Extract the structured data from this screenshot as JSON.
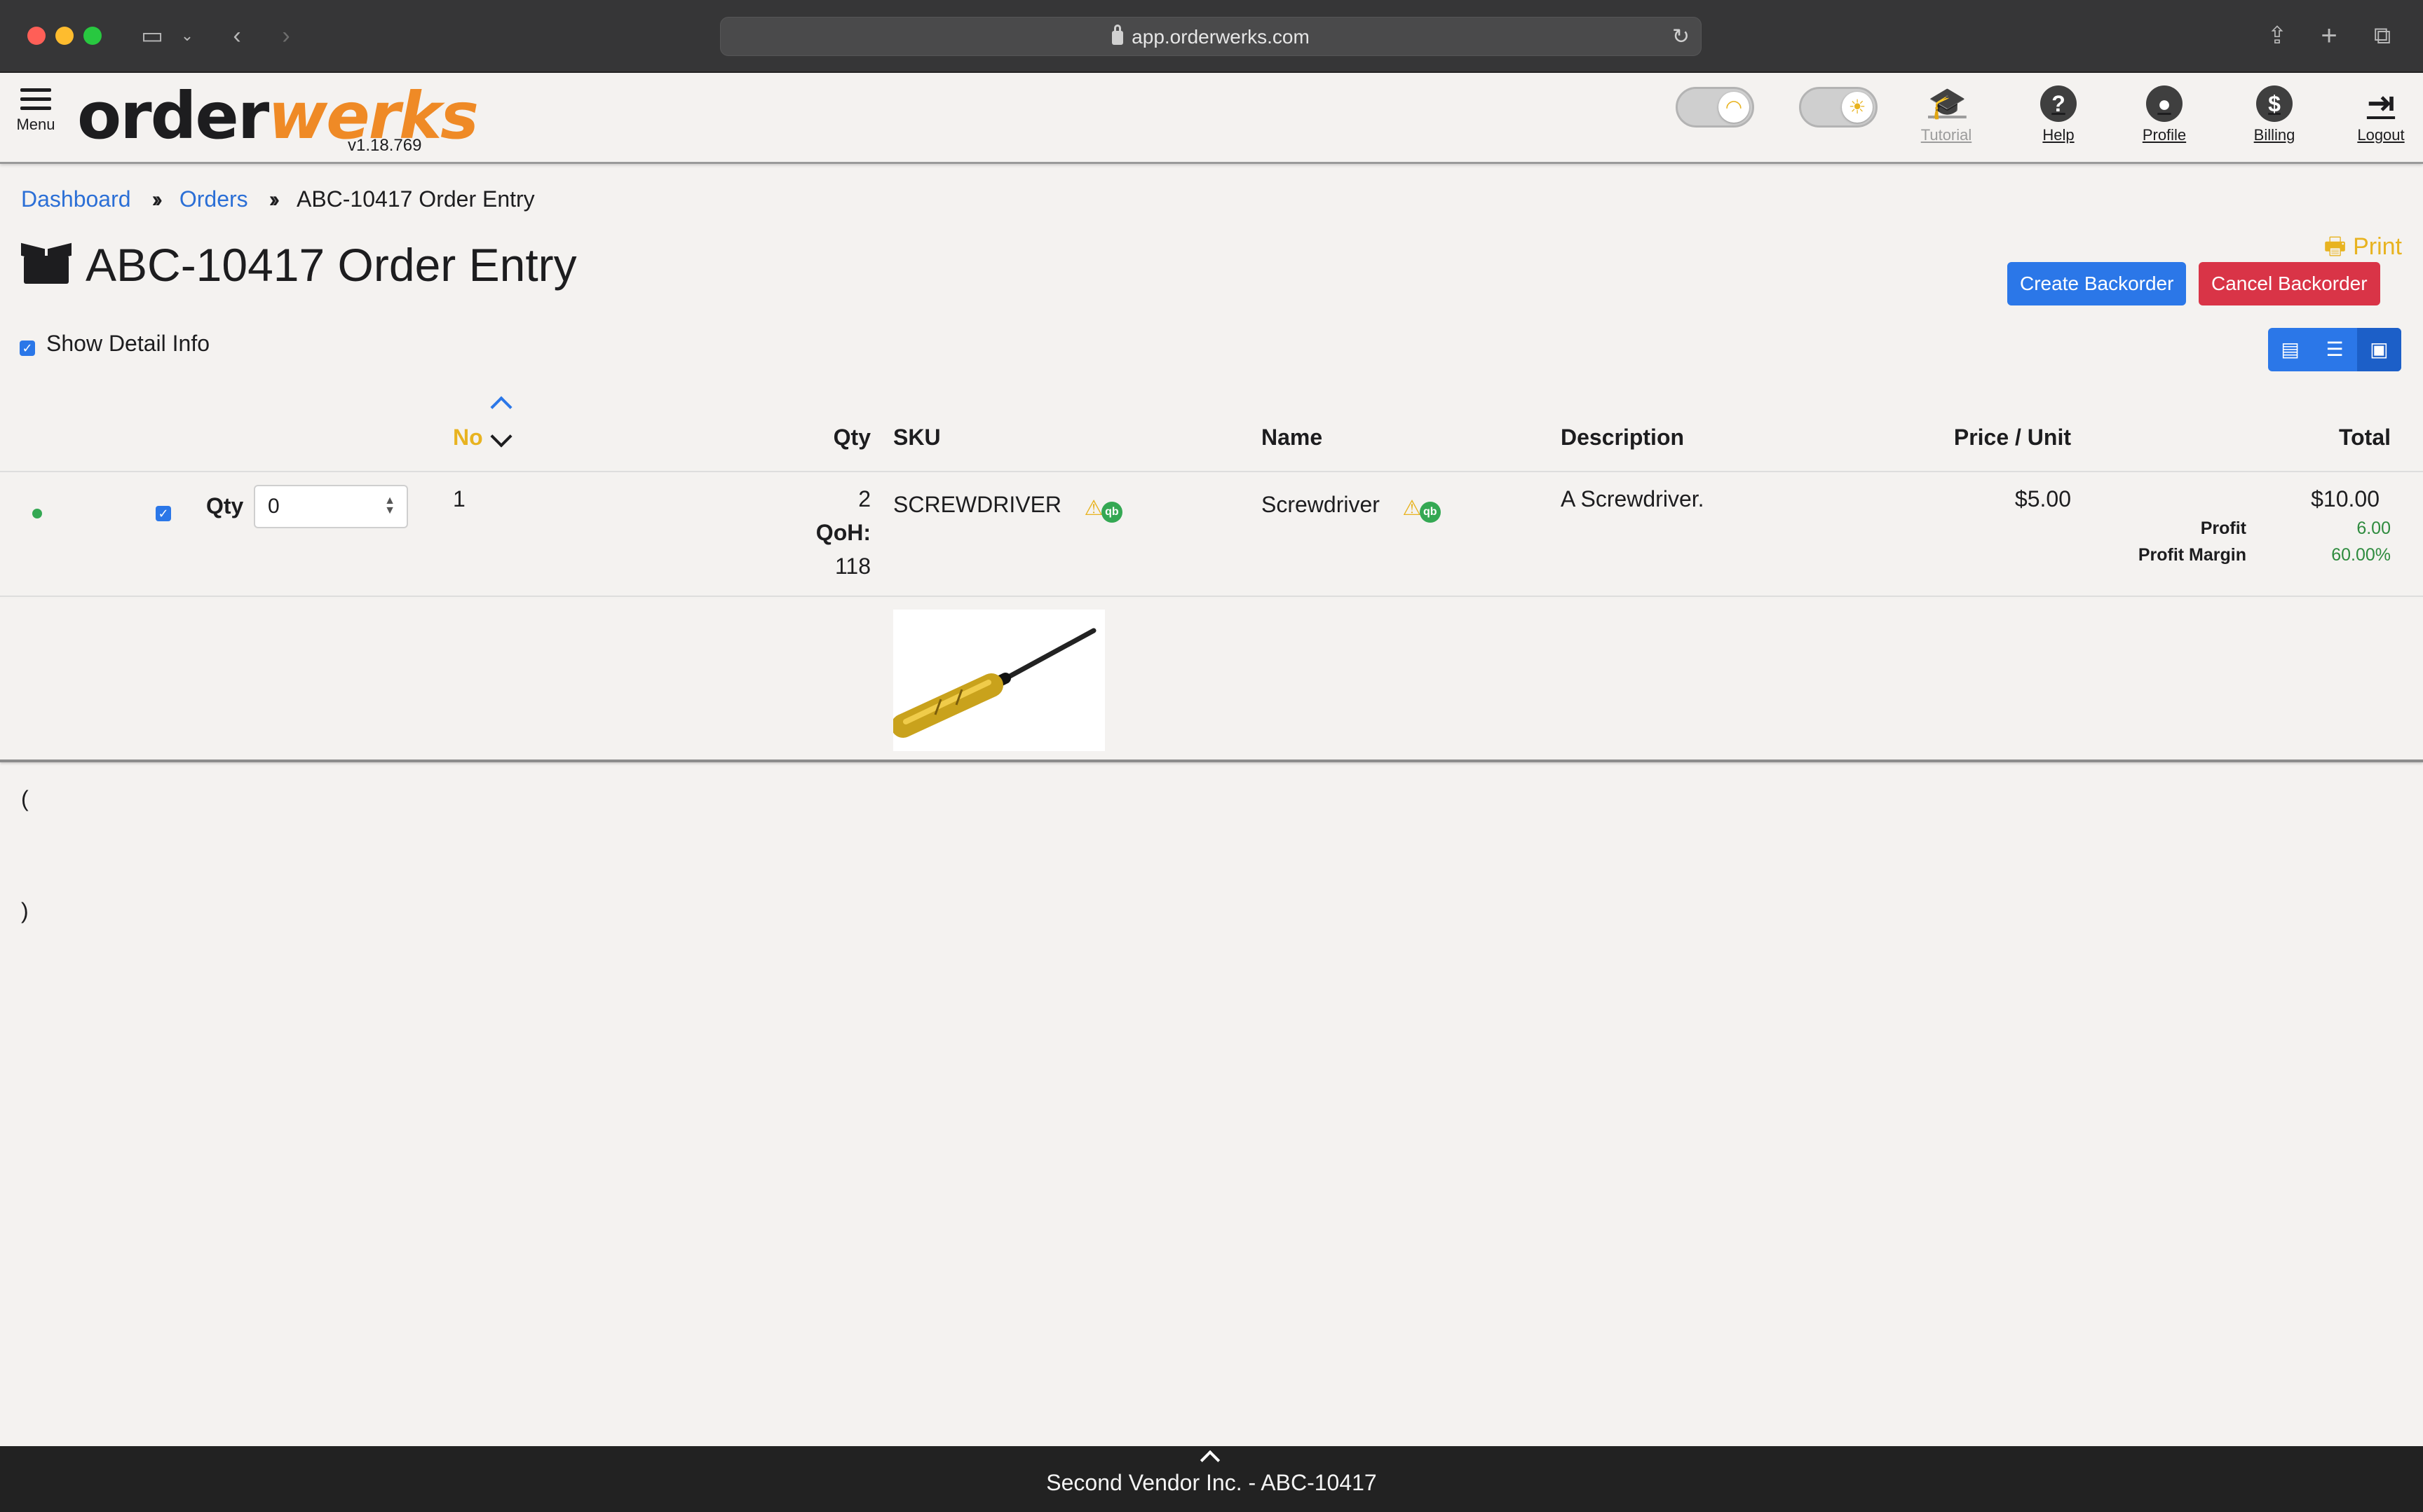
{
  "browser": {
    "url": "app.orderwerks.com"
  },
  "header": {
    "menu_label": "Menu",
    "logo_part1": "order",
    "logo_part2": "werks",
    "version": "v1.18.769",
    "nav": {
      "tutorial": "Tutorial",
      "help": "Help",
      "profile": "Profile",
      "billing": "Billing",
      "logout": "Logout"
    }
  },
  "breadcrumb": {
    "dashboard": "Dashboard",
    "orders": "Orders",
    "current": "ABC-10417 Order Entry"
  },
  "page": {
    "title": "ABC-10417 Order Entry",
    "print_label": "Print",
    "create_backorder": "Create Backorder",
    "cancel_backorder": "Cancel Backorder",
    "show_detail_label": "Show Detail Info",
    "show_detail_checked": true
  },
  "table": {
    "columns": {
      "no": "No",
      "qty": "Qty",
      "sku": "SKU",
      "name": "Name",
      "description": "Description",
      "price": "Price / Unit",
      "total": "Total"
    },
    "row": {
      "status_color": "#34a853",
      "checked": true,
      "qty_label": "Qty",
      "qty_value": "0",
      "no": "1",
      "qty": "2",
      "qoh_label": "QoH:",
      "qoh_value": "118",
      "sku": "SCREWDRIVER",
      "name": "Screwdriver",
      "description": "A Screwdriver.",
      "price": "$5.00",
      "total": "$10.00",
      "profit_label": "Profit",
      "profit_value": "6.00",
      "margin_label": "Profit Margin",
      "margin_value": "60.00%"
    }
  },
  "notes": {
    "open": "(",
    "close": ")"
  },
  "footer": {
    "text": "Second Vendor Inc. - ABC-10417"
  },
  "colors": {
    "accent_blue": "#2b77e8",
    "danger_red": "#d93447",
    "brand_orange": "#ef8a26",
    "print_yellow": "#e8b320"
  }
}
